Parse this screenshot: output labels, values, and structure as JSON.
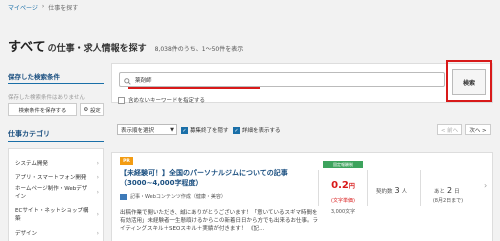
{
  "breadcrumb": {
    "home": "マイページ",
    "sep": "›",
    "current": "仕事を探す"
  },
  "heading": {
    "all": "すべて",
    "rest": "の仕事・求人情報を探す",
    "count": "8,038件のうち、1〜50件を表示"
  },
  "sidebar": {
    "saved_title": "保存した検索条件",
    "saved_note": "保存した検索条件はありません",
    "save_button": "検索条件を保存する",
    "settings_button": "設定",
    "category_title": "仕事カテゴリ",
    "categories": [
      {
        "label": "システム開発"
      },
      {
        "label": "アプリ・スマートフォン開発"
      },
      {
        "label": "ホームページ制作・Webデザ"
      },
      {
        "label": "イン"
      },
      {
        "label": "ECサイト・ネットショップ構"
      },
      {
        "label": "築"
      },
      {
        "label": "デザイン"
      }
    ]
  },
  "search": {
    "value": "薬剤師",
    "exclude_label": "含めないキーワードを指定する",
    "button": "検索"
  },
  "sort": {
    "select_value": "表示順を選択",
    "hide_closed": "募集終了を隠す",
    "show_detail": "詳細を表示する",
    "prev": "< 前へ",
    "next": "次へ >"
  },
  "job": {
    "badge": "PR",
    "title": "【未経験可！】全国のパーソナルジムについての記事（3000~4,000字程度）",
    "tags": "記事・Webコンテンツ作成（健康・美容）",
    "description": "出稿作業で閲いただき、誠にありがとうございます！「意いているスギマ時間を有効活用」未経験者一生懸頑けるからこの新着日日から方でも出来るお仕事。ライティングスキル＋SEOスキル＋実績が付きます！ 《記...",
    "fee_badge": "固定報酬制",
    "fee_value": "0.2",
    "fee_unit": "円",
    "fee_unit_note": "(文字単価)",
    "fee_total": "3,000文字",
    "contracts_label": "契約数",
    "contracts_value": "3",
    "contracts_unit": "人",
    "deadline_label": "あと",
    "deadline_value": "2",
    "deadline_unit": "日",
    "deadline_date": "(8月2日まで)"
  }
}
